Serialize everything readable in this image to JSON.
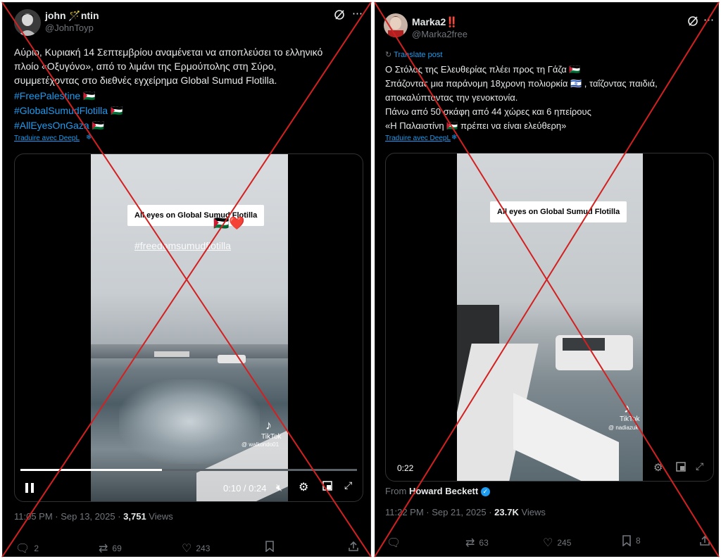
{
  "colors": {
    "background": "#000000",
    "text": "#e7e9ea",
    "muted": "#71767b",
    "link": "#1d9bf0",
    "cross": "#d32020",
    "verified": "#1d9bf0"
  },
  "post1": {
    "username": "john 🪄ntin",
    "handle": "@JohnToyp",
    "text_lines": [
      "Αύριο, Κυριακή 14 Σεπτεμβρίου αναμένεται να αποπλεύσει το ελληνικό",
      "πλοίο «Οξυγόνο», από το λιμάνι της Ερμούπολης στη Σύρο,",
      "συμμετέχοντας στο διεθνές εγχείρημα Global Sumud Flotilla."
    ],
    "hashtags": [
      "#FreePalestine 🇵🇸",
      "#GlobalSumudFlotilla 🇵🇸",
      "#AllEyesOnGaza 🇵🇸"
    ],
    "translate_link": "Traduire avec DeepL",
    "video": {
      "overlay_title": "All eyes on Global Sumud Flotilla",
      "overlay_subtitle": "#freedomsumudflotilla",
      "emoji": "🇵🇸❤️",
      "watermark": "TikTok",
      "watermark_user": "@ walkondo01",
      "time": "0:10 / 0:24",
      "progress": 0.42
    },
    "timestamp": "11:05 PM · Sep 13, 2025 · ",
    "views_count": "3,751",
    "views_label": " Views",
    "replies": "2",
    "reposts": "69",
    "likes": "243"
  },
  "post2": {
    "username": "Marka2‼️",
    "handle": "@Marka2free",
    "translate_post": "Translate post",
    "text_lines": [
      "Ο Στόλος της Ελευθερίας πλέει προς τη Γάζα 🇵🇸",
      "Σπάζοντας μια παράνομη 18χρονη πολιορκία 🇮🇱 , ταΐζοντας παιδιά,",
      "αποκαλύπτοντας την γενοκτονία.",
      "Πάνω από 50 σκάφη από 44 χώρες και 6 ηπείρους",
      "«Η Παλαιστίνη 🇵🇸 πρέπει να είναι ελεύθερη»"
    ],
    "translate_link": "Traduire avec DeepL",
    "video": {
      "overlay_title": "All eyes on Global Sumud Flotilla",
      "watermark": "TikTok",
      "watermark_user": "@ nadiazuk",
      "time": "0:22"
    },
    "from_label": "From ",
    "from_name": "Howard Beckett",
    "timestamp": "11:22 PM · Sep 21, 2025 · ",
    "views_count": "23.7K",
    "views_label": " Views",
    "reposts": "63",
    "likes": "245",
    "bookmarks": "8"
  }
}
